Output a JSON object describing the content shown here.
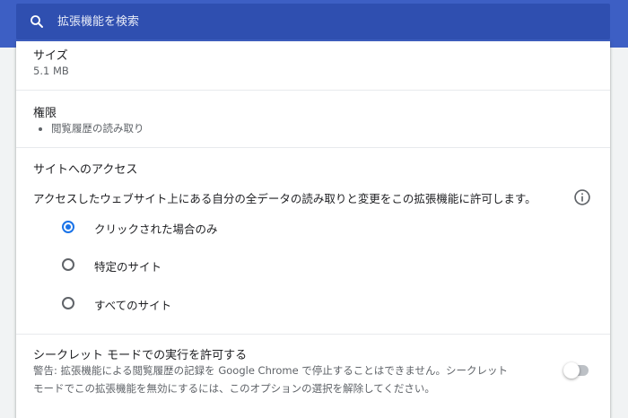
{
  "search": {
    "placeholder": "拡張機能を検索"
  },
  "size": {
    "label": "サイズ",
    "value": "5.1 MB"
  },
  "permissions": {
    "label": "権限",
    "items": [
      "閲覧履歴の読み取り"
    ]
  },
  "site_access": {
    "label": "サイトへのアクセス",
    "description": "アクセスしたウェブサイト上にある自分の全データの読み取りと変更をこの拡張機能に許可します。",
    "selected": "on_click",
    "options": [
      {
        "id": "on_click",
        "label": "クリックされた場合のみ"
      },
      {
        "id": "specific",
        "label": "特定のサイト"
      },
      {
        "id": "all",
        "label": "すべてのサイト"
      }
    ]
  },
  "incognito": {
    "label": "シークレット モードでの実行を許可する",
    "warning_line1": "警告: 拡張機能による閲覧履歴の記録を Google Chrome で停止することはできません。シークレット",
    "warning_line2": "モードでこの拡張機能を無効にするには、このオプションの選択を解除してください。",
    "enabled": false
  },
  "icons": {
    "search": "search-icon",
    "info": "info-icon",
    "toggle": "toggle-switch"
  },
  "colors": {
    "header": "#3d5fc4",
    "search_box": "#2f4fb0",
    "accent": "#1a73e8",
    "divider": "#e8eaed",
    "background": "#f1f3f4"
  }
}
